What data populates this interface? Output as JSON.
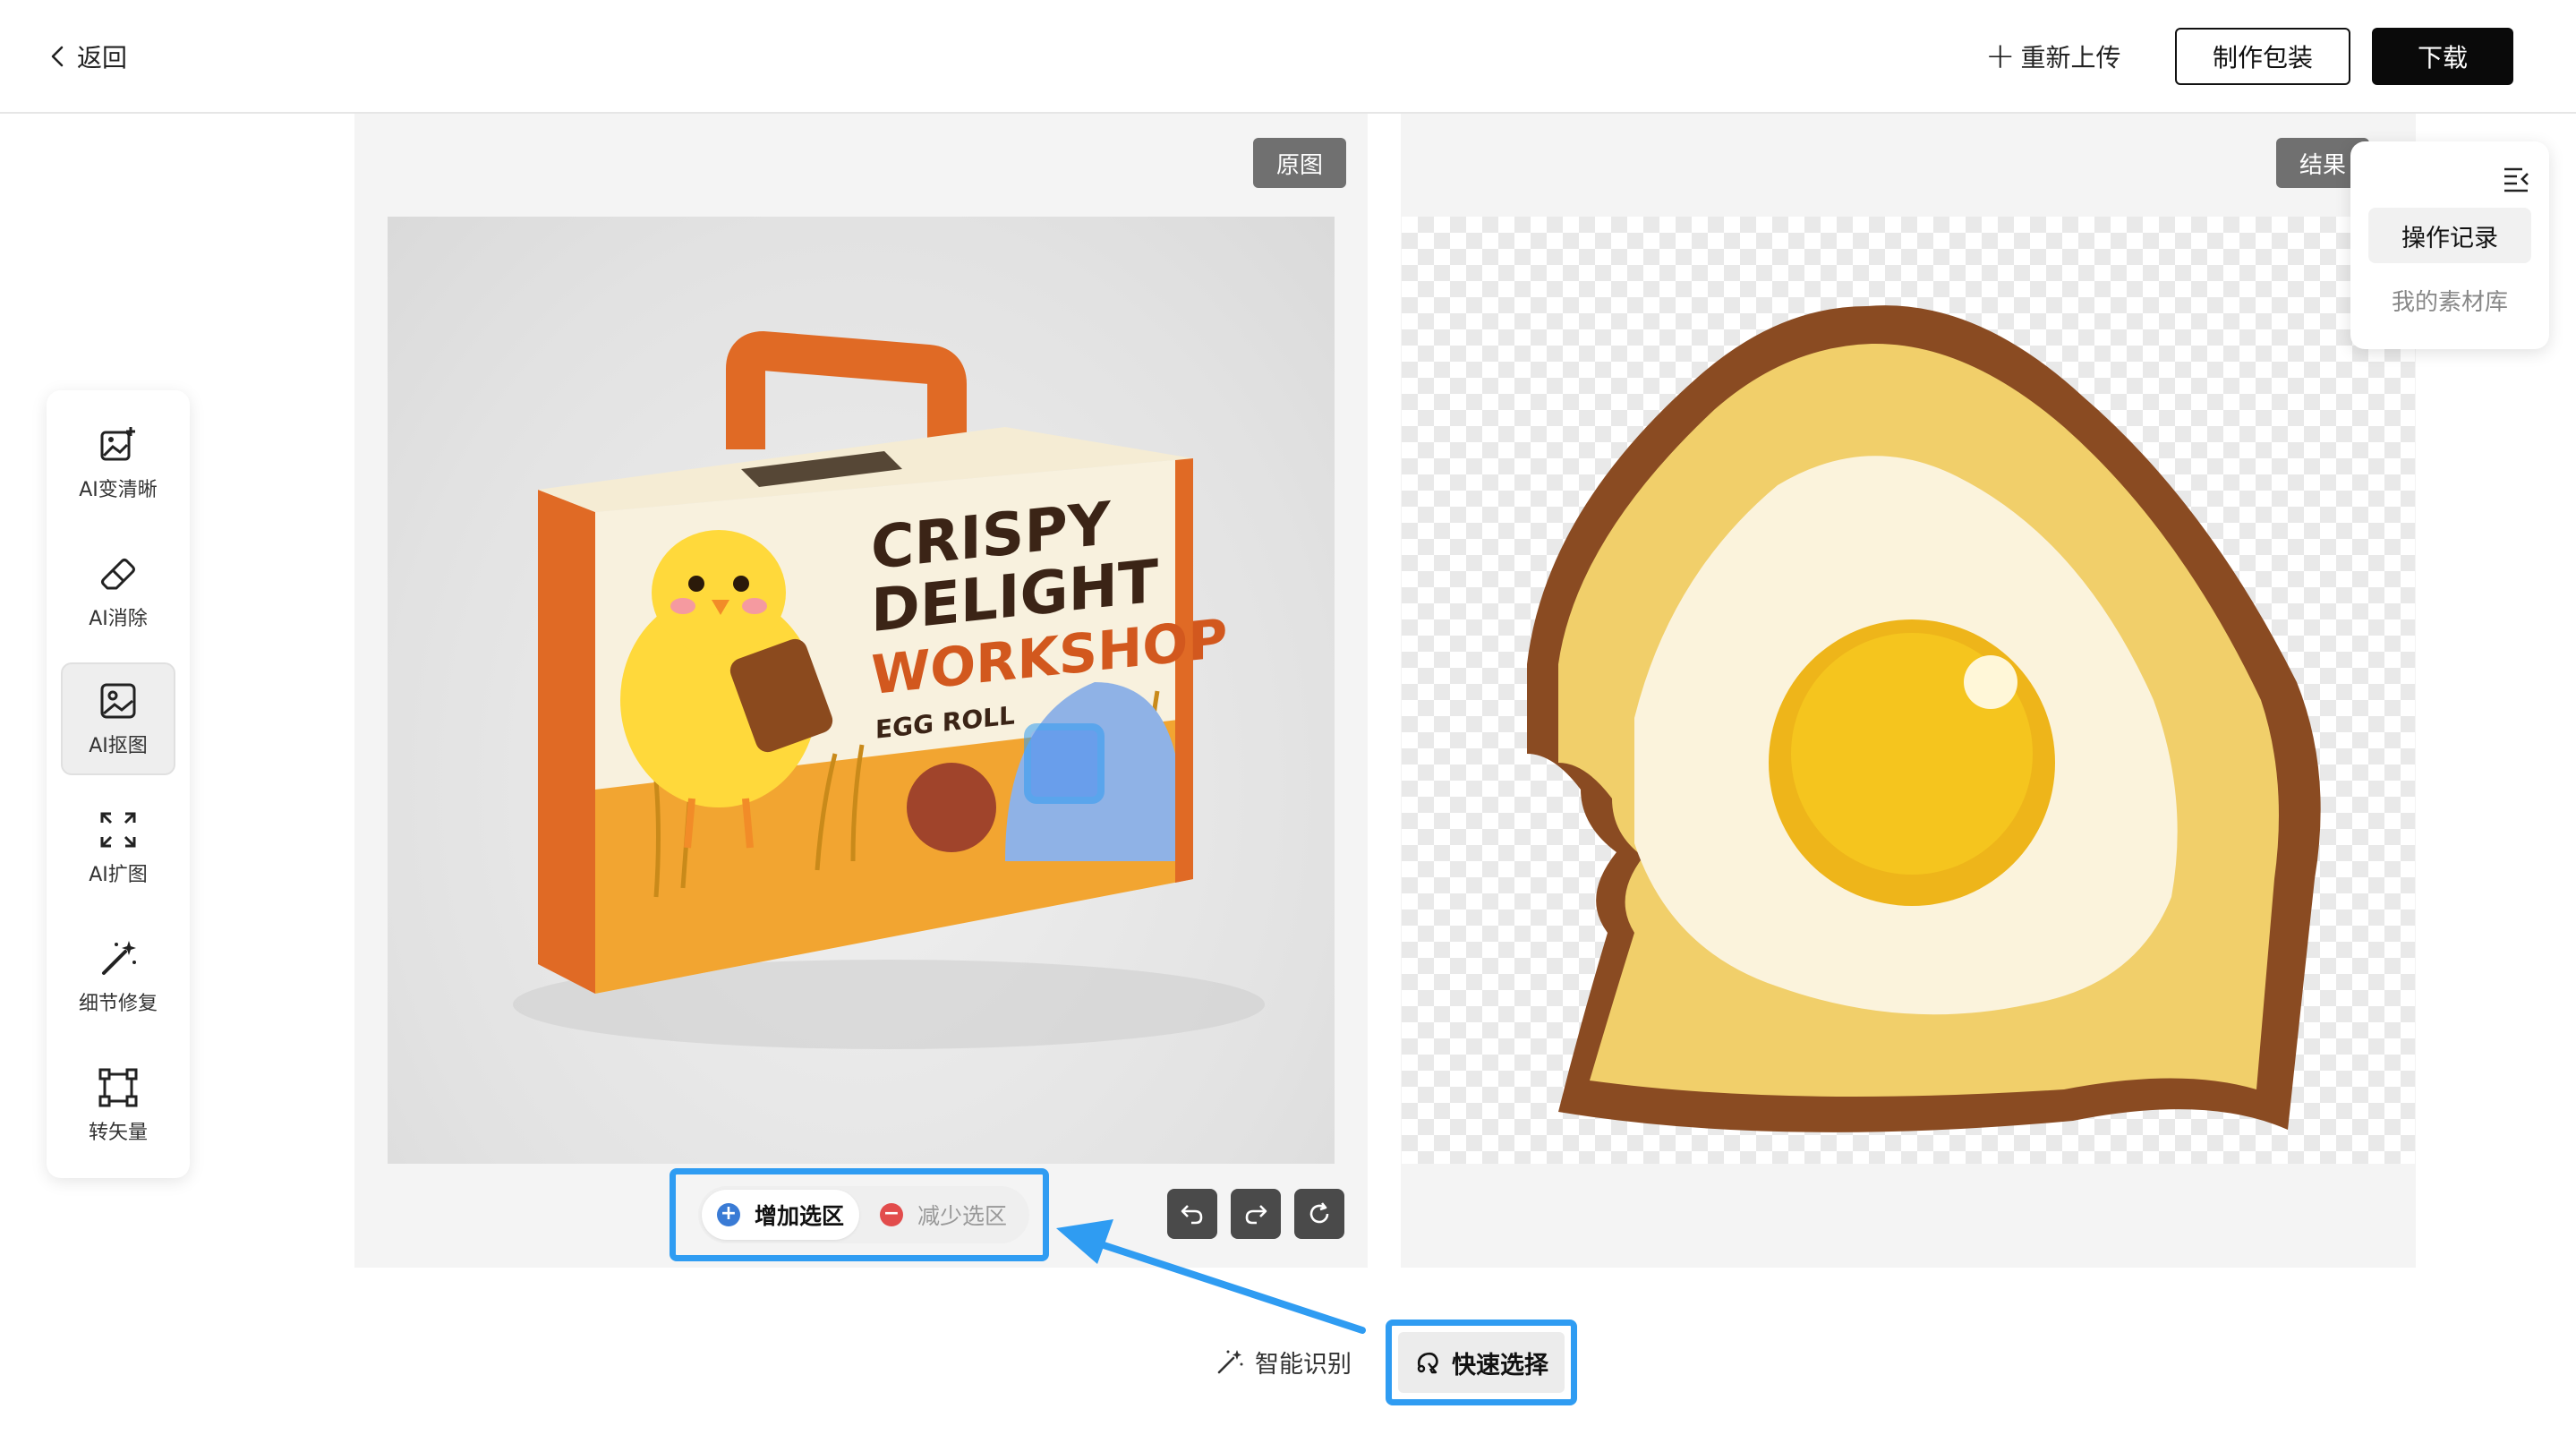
{
  "header": {
    "back_label": "返回",
    "reupload_label": "重新上传",
    "make_package_label": "制作包装",
    "download_label": "下载"
  },
  "panels": {
    "original_tag": "原图",
    "result_tag": "结果"
  },
  "product_box": {
    "title_line1": "CRISPY",
    "title_line2": "DELIGHT",
    "title_line3": "WORKSHOP",
    "subtitle": "EGG ROLL"
  },
  "sidebar": {
    "items": [
      {
        "label": "AI变清晰",
        "icon": "image-enhance-icon"
      },
      {
        "label": "AI消除",
        "icon": "eraser-icon"
      },
      {
        "label": "AI抠图",
        "icon": "image-cutout-icon",
        "active": true
      },
      {
        "label": "AI扩图",
        "icon": "expand-icon"
      },
      {
        "label": "细节修复",
        "icon": "magic-wand-icon"
      },
      {
        "label": "转矢量",
        "icon": "vector-icon"
      }
    ]
  },
  "right_panel": {
    "history_label": "操作记录",
    "library_label": "我的素材库"
  },
  "selection_mode": {
    "add_label": "增加选区",
    "remove_label": "减少选区",
    "add_color": "#3a7bd5",
    "remove_color": "#e24c4c"
  },
  "bottom_tools": {
    "smart_label": "智能识别",
    "quick_label": "快速选择"
  },
  "colors": {
    "highlight": "#2f9cf2",
    "primary_button": "#0a0a0a",
    "box_orange": "#e06a25"
  }
}
